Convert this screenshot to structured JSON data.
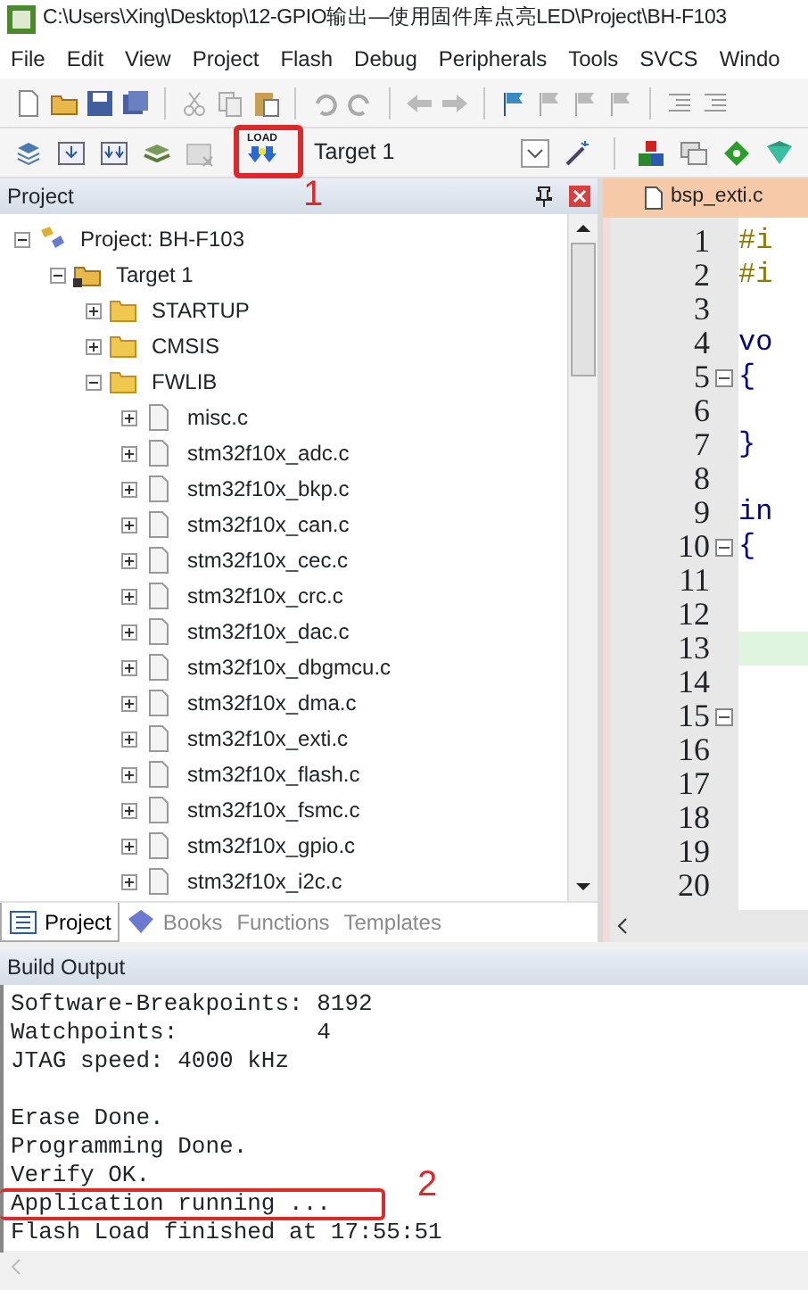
{
  "window": {
    "title": "C:\\Users\\Xing\\Desktop\\12-GPIO输出—使用固件库点亮LED\\Project\\BH-F103"
  },
  "menu": [
    "File",
    "Edit",
    "View",
    "Project",
    "Flash",
    "Debug",
    "Peripherals",
    "Tools",
    "SVCS",
    "Windo"
  ],
  "build_toolbar": {
    "load_label": "LOAD",
    "target": "Target 1"
  },
  "project_panel": {
    "title": "Project",
    "tree": [
      {
        "label": "Project: BH-F103",
        "kind": "project",
        "expanded": true,
        "children": [
          {
            "label": "Target 1",
            "kind": "target",
            "expanded": true,
            "children": [
              {
                "label": "STARTUP",
                "kind": "folder",
                "expanded": false
              },
              {
                "label": "CMSIS",
                "kind": "folder",
                "expanded": false
              },
              {
                "label": "FWLIB",
                "kind": "folder",
                "expanded": true,
                "children": [
                  {
                    "label": "misc.c",
                    "kind": "file",
                    "expanded": false
                  },
                  {
                    "label": "stm32f10x_adc.c",
                    "kind": "file",
                    "expanded": false
                  },
                  {
                    "label": "stm32f10x_bkp.c",
                    "kind": "file",
                    "expanded": false
                  },
                  {
                    "label": "stm32f10x_can.c",
                    "kind": "file",
                    "expanded": false
                  },
                  {
                    "label": "stm32f10x_cec.c",
                    "kind": "file",
                    "expanded": false
                  },
                  {
                    "label": "stm32f10x_crc.c",
                    "kind": "file",
                    "expanded": false
                  },
                  {
                    "label": "stm32f10x_dac.c",
                    "kind": "file",
                    "expanded": false
                  },
                  {
                    "label": "stm32f10x_dbgmcu.c",
                    "kind": "file",
                    "expanded": false
                  },
                  {
                    "label": "stm32f10x_dma.c",
                    "kind": "file",
                    "expanded": false
                  },
                  {
                    "label": "stm32f10x_exti.c",
                    "kind": "file",
                    "expanded": false
                  },
                  {
                    "label": "stm32f10x_flash.c",
                    "kind": "file",
                    "expanded": false
                  },
                  {
                    "label": "stm32f10x_fsmc.c",
                    "kind": "file",
                    "expanded": false
                  },
                  {
                    "label": "stm32f10x_gpio.c",
                    "kind": "file",
                    "expanded": false
                  },
                  {
                    "label": "stm32f10x_i2c.c",
                    "kind": "file",
                    "expanded": false
                  }
                ]
              }
            ]
          }
        ]
      }
    ],
    "tabs": [
      {
        "label": "Project",
        "selected": true
      },
      {
        "label": "Books",
        "selected": false
      },
      {
        "label": "Functions",
        "selected": false
      },
      {
        "label": "Templates",
        "selected": false
      }
    ]
  },
  "editor": {
    "tab": "bsp_exti.c",
    "lines": [
      {
        "number": "1",
        "code": "#i",
        "fold": false,
        "highlighted": false
      },
      {
        "number": "2",
        "code": "#i",
        "fold": false,
        "highlighted": false
      },
      {
        "number": "3",
        "fold": false,
        "highlighted": false
      },
      {
        "number": "4",
        "code": "vo",
        "fold": false,
        "highlighted": false
      },
      {
        "number": "5",
        "code": "{",
        "fold": true,
        "highlighted": false
      },
      {
        "number": "6",
        "fold": false,
        "highlighted": false
      },
      {
        "number": "7",
        "code": "}",
        "fold": false,
        "highlighted": false
      },
      {
        "number": "8",
        "fold": false,
        "highlighted": false
      },
      {
        "number": "9",
        "code": "in",
        "fold": false,
        "highlighted": false
      },
      {
        "number": "10",
        "code": "{",
        "fold": true,
        "highlighted": false
      },
      {
        "number": "11",
        "fold": false,
        "highlighted": false
      },
      {
        "number": "12",
        "fold": false,
        "highlighted": false
      },
      {
        "number": "13",
        "fold": false,
        "highlighted": true
      },
      {
        "number": "14",
        "fold": false,
        "highlighted": false
      },
      {
        "number": "15",
        "fold": true,
        "highlighted": false
      },
      {
        "number": "16",
        "fold": false,
        "highlighted": false
      },
      {
        "number": "17",
        "fold": false,
        "highlighted": false
      },
      {
        "number": "18",
        "fold": false,
        "highlighted": false
      },
      {
        "number": "19",
        "fold": false,
        "highlighted": false
      },
      {
        "number": "20",
        "fold": false,
        "highlighted": false
      }
    ]
  },
  "build_output": {
    "title": "Build Output",
    "groups": [
      [
        "Software-Breakpoints: 8192",
        "Watchpoints:          4",
        "JTAG speed: 4000 kHz"
      ],
      [
        "Erase Done.",
        "Programming Done.",
        "Verify OK.",
        "Application running ...",
        "Flash Load finished at 17:55:51"
      ]
    ]
  },
  "annotations": [
    "1",
    "2"
  ]
}
